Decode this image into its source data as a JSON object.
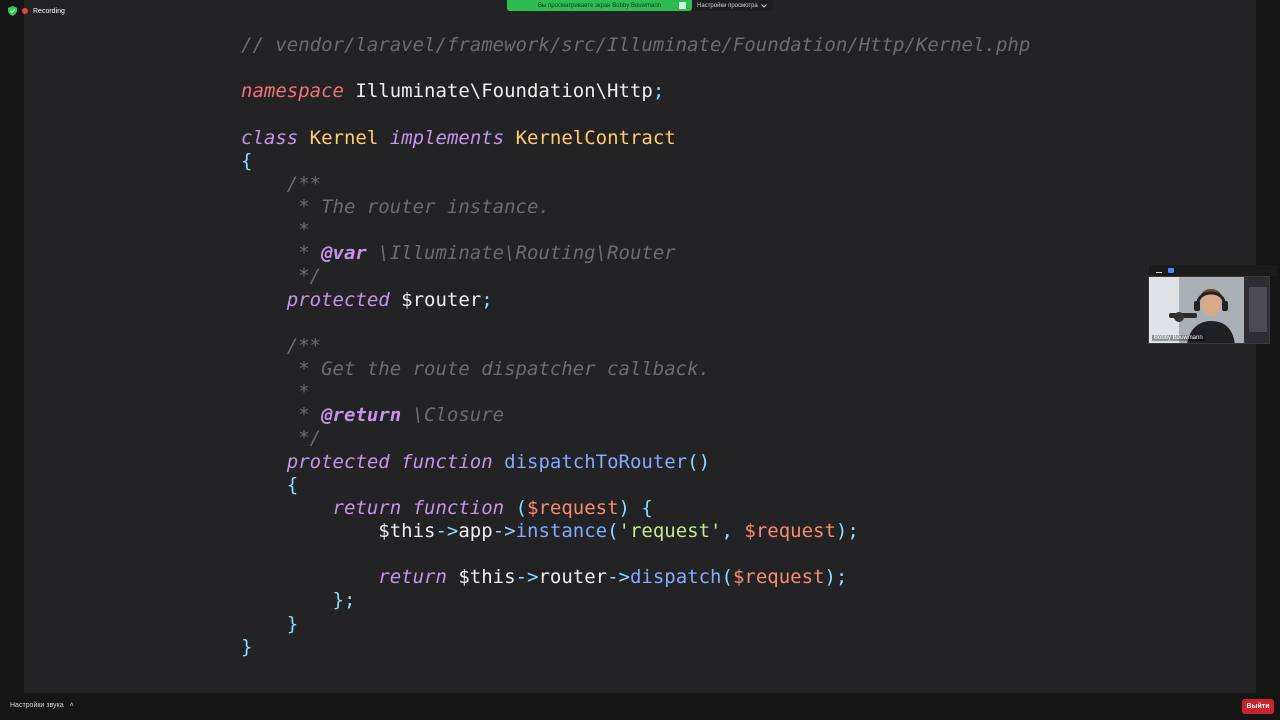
{
  "recording": {
    "label": "Recording"
  },
  "share_banner": {
    "text": "Вы просматриваете экран Bobby Bouwmann",
    "view_options": "Настройки просмотра",
    "view_options_icon": "chevron-down-icon"
  },
  "participant": {
    "name": "Bobby Bouwmann"
  },
  "bottom_bar": {
    "audio_settings": "Настройки звука",
    "audio_chevron": "˄",
    "leave": "Выйти"
  },
  "colors": {
    "comment": "#6c6c70",
    "keyword": "#c792ea",
    "namespace": "#f07178",
    "class": "#ffcb6b",
    "punct": "#89ddff",
    "variable": "#f78c6c",
    "function": "#82aaff",
    "string": "#c3e88d",
    "banner": "#2fbd53",
    "leave": "#c9232b"
  },
  "code": [
    [
      [
        "comment",
        "// vendor/laravel/framework/src/Illuminate/Foundation/Http/Kernel.php"
      ]
    ],
    [],
    [
      [
        "ns",
        "namespace"
      ],
      [
        "plain",
        " Illuminate\\Foundation\\Http"
      ],
      [
        "punct",
        ";"
      ]
    ],
    [],
    [
      [
        "kw",
        "class"
      ],
      [
        "plain",
        " "
      ],
      [
        "class",
        "Kernel"
      ],
      [
        "plain",
        " "
      ],
      [
        "kw",
        "implements"
      ],
      [
        "plain",
        " "
      ],
      [
        "class",
        "KernelContract"
      ]
    ],
    [
      [
        "punct",
        "{"
      ]
    ],
    [
      [
        "comment",
        "    /**"
      ]
    ],
    [
      [
        "comment",
        "     * The router instance."
      ]
    ],
    [
      [
        "comment",
        "     *"
      ]
    ],
    [
      [
        "comment",
        "     * "
      ],
      [
        "tag",
        "@var"
      ],
      [
        "comment",
        " \\Illuminate\\Routing\\Router"
      ]
    ],
    [
      [
        "comment",
        "     */"
      ]
    ],
    [
      [
        "plain",
        "    "
      ],
      [
        "kw",
        "protected"
      ],
      [
        "plain",
        " $router"
      ],
      [
        "punct",
        ";"
      ]
    ],
    [],
    [
      [
        "comment",
        "    /**"
      ]
    ],
    [
      [
        "comment",
        "     * Get the route dispatcher callback."
      ]
    ],
    [
      [
        "comment",
        "     *"
      ]
    ],
    [
      [
        "comment",
        "     * "
      ],
      [
        "tag",
        "@return"
      ],
      [
        "comment",
        " \\Closure"
      ]
    ],
    [
      [
        "comment",
        "     */"
      ]
    ],
    [
      [
        "plain",
        "    "
      ],
      [
        "kw",
        "protected"
      ],
      [
        "plain",
        " "
      ],
      [
        "kw",
        "function"
      ],
      [
        "plain",
        " "
      ],
      [
        "fn",
        "dispatchToRouter"
      ],
      [
        "punct",
        "()"
      ]
    ],
    [
      [
        "plain",
        "    "
      ],
      [
        "punct",
        "{"
      ]
    ],
    [
      [
        "plain",
        "        "
      ],
      [
        "kw",
        "return"
      ],
      [
        "plain",
        " "
      ],
      [
        "kw",
        "function"
      ],
      [
        "plain",
        " "
      ],
      [
        "punct",
        "("
      ],
      [
        "var",
        "$request"
      ],
      [
        "punct",
        ") {"
      ]
    ],
    [
      [
        "plain",
        "            $this"
      ],
      [
        "punct",
        "->"
      ],
      [
        "plain",
        "app"
      ],
      [
        "punct",
        "->"
      ],
      [
        "fn",
        "instance"
      ],
      [
        "punct",
        "("
      ],
      [
        "str",
        "'request'"
      ],
      [
        "punct",
        ", "
      ],
      [
        "var",
        "$request"
      ],
      [
        "punct",
        ");"
      ]
    ],
    [],
    [
      [
        "plain",
        "            "
      ],
      [
        "kw",
        "return"
      ],
      [
        "plain",
        " $this"
      ],
      [
        "punct",
        "->"
      ],
      [
        "plain",
        "router"
      ],
      [
        "punct",
        "->"
      ],
      [
        "fn",
        "dispatch"
      ],
      [
        "punct",
        "("
      ],
      [
        "var",
        "$request"
      ],
      [
        "punct",
        ");"
      ]
    ],
    [
      [
        "plain",
        "        "
      ],
      [
        "punct",
        "};"
      ]
    ],
    [
      [
        "plain",
        "    "
      ],
      [
        "punct",
        "}"
      ]
    ],
    [
      [
        "punct",
        "}"
      ]
    ]
  ]
}
